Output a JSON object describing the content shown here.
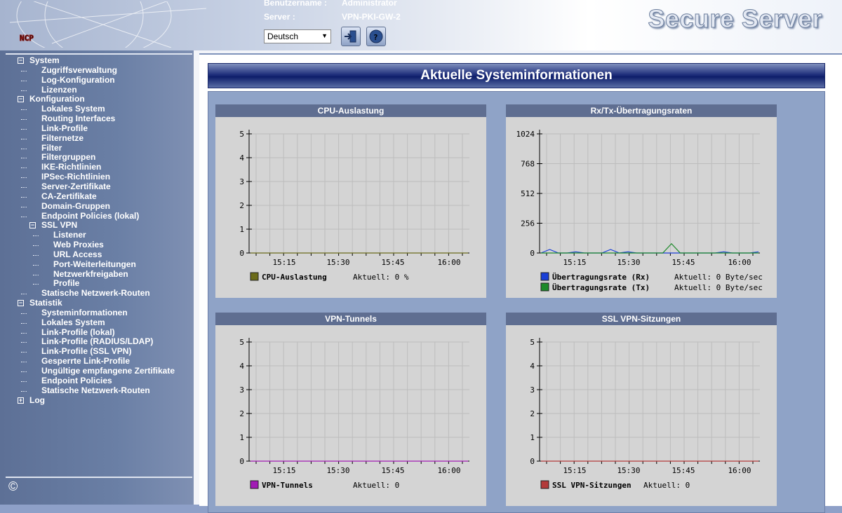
{
  "header": {
    "user_label": "Benutzername :",
    "user_value": "Administrator",
    "server_label": "Server :",
    "server_value": "VPN-PKI-GW-2",
    "language": "Deutsch",
    "logo_text": "NCP",
    "brand": "Secure Server",
    "icons": [
      "logout-icon",
      "help-icon"
    ]
  },
  "sidebar": {
    "copyright": "©",
    "tree": [
      {
        "label": "System",
        "level": 0,
        "expander": "minus"
      },
      {
        "label": "Zugriffsverwaltung",
        "level": 1
      },
      {
        "label": "Log-Konfiguration",
        "level": 1
      },
      {
        "label": "Lizenzen",
        "level": 1
      },
      {
        "label": "Konfiguration",
        "level": 0,
        "expander": "minus"
      },
      {
        "label": "Lokales System",
        "level": 1
      },
      {
        "label": "Routing Interfaces",
        "level": 1
      },
      {
        "label": "Link-Profile",
        "level": 1
      },
      {
        "label": "Filternetze",
        "level": 1
      },
      {
        "label": "Filter",
        "level": 1
      },
      {
        "label": "Filtergruppen",
        "level": 1
      },
      {
        "label": "IKE-Richtlinien",
        "level": 1
      },
      {
        "label": "IPSec-Richtlinien",
        "level": 1
      },
      {
        "label": "Server-Zertifikate",
        "level": 1
      },
      {
        "label": "CA-Zertifikate",
        "level": 1
      },
      {
        "label": "Domain-Gruppen",
        "level": 1
      },
      {
        "label": "Endpoint Policies (lokal)",
        "level": 1
      },
      {
        "label": "SSL VPN",
        "level": 1,
        "expander": "minus"
      },
      {
        "label": "Listener",
        "level": 2
      },
      {
        "label": "Web Proxies",
        "level": 2
      },
      {
        "label": "URL Access",
        "level": 2
      },
      {
        "label": "Port-Weiterleitungen",
        "level": 2
      },
      {
        "label": "Netzwerkfreigaben",
        "level": 2
      },
      {
        "label": "Profile",
        "level": 2
      },
      {
        "label": "Statische Netzwerk-Routen",
        "level": 1
      },
      {
        "label": "Statistik",
        "level": 0,
        "expander": "minus"
      },
      {
        "label": "Systeminformationen",
        "level": 1
      },
      {
        "label": "Lokales System",
        "level": 1
      },
      {
        "label": "Link-Profile (lokal)",
        "level": 1
      },
      {
        "label": "Link-Profile (RADIUS/LDAP)",
        "level": 1
      },
      {
        "label": "Link-Profile (SSL VPN)",
        "level": 1
      },
      {
        "label": "Gesperrte Link-Profile",
        "level": 1
      },
      {
        "label": "Ungültige empfangene Zertifikate",
        "level": 1
      },
      {
        "label": "Endpoint Policies",
        "level": 1
      },
      {
        "label": "Statische Netzwerk-Routen",
        "level": 1
      },
      {
        "label": "Log",
        "level": 0,
        "expander": "plus"
      }
    ]
  },
  "main": {
    "title": "Aktuelle Systeminformationen"
  },
  "chart_data": [
    {
      "type": "line",
      "title": "CPU-Auslastung",
      "ylim": [
        0,
        5
      ],
      "yticks": [
        "0",
        "1",
        "2",
        "3",
        "4",
        "5"
      ],
      "xticks": [
        "15:15",
        "15:30",
        "15:45",
        "16:00"
      ],
      "series": [
        {
          "name": "CPU-Auslastung",
          "color": "#6b6b1a",
          "current": "Aktuell: 0 %",
          "values": [
            0,
            0,
            0,
            0,
            0,
            0,
            0,
            0,
            0,
            0,
            0,
            0,
            0,
            0,
            0,
            0,
            0,
            0,
            0,
            0,
            0,
            0,
            0,
            0,
            0,
            0
          ]
        }
      ]
    },
    {
      "type": "line",
      "title": "Rx/Tx-Übertragungsraten",
      "ylim": [
        0,
        1024
      ],
      "yticks": [
        "0",
        "256",
        "512",
        "768",
        "1024"
      ],
      "xticks": [
        "15:15",
        "15:30",
        "15:45",
        "16:00"
      ],
      "series": [
        {
          "name": "Übertragungsrate (Rx)",
          "color": "#1a3fd6",
          "current": "Aktuell: 0 Byte/sec",
          "values": [
            0,
            30,
            0,
            0,
            10,
            0,
            0,
            0,
            30,
            0,
            10,
            0,
            0,
            0,
            0,
            0,
            0,
            0,
            0,
            0,
            0,
            10,
            0,
            0,
            0,
            10
          ]
        },
        {
          "name": "Übertragungsrate (Tx)",
          "color": "#1d8a2a",
          "current": "Aktuell: 0 Byte/sec",
          "values": [
            0,
            0,
            0,
            0,
            0,
            0,
            0,
            0,
            0,
            0,
            0,
            0,
            0,
            0,
            0,
            80,
            0,
            0,
            0,
            0,
            0,
            0,
            0,
            0,
            0,
            0
          ]
        }
      ]
    },
    {
      "type": "line",
      "title": "VPN-Tunnels",
      "ylim": [
        0,
        5
      ],
      "yticks": [
        "0",
        "1",
        "2",
        "3",
        "4",
        "5"
      ],
      "xticks": [
        "15:15",
        "15:30",
        "15:45",
        "16:00"
      ],
      "series": [
        {
          "name": "VPN-Tunnels",
          "color": "#a21bb5",
          "current": "Aktuell: 0",
          "values": [
            0,
            0,
            0,
            0,
            0,
            0,
            0,
            0,
            0,
            0,
            0,
            0,
            0,
            0,
            0,
            0,
            0,
            0,
            0,
            0,
            0,
            0,
            0,
            0,
            0,
            0
          ]
        }
      ]
    },
    {
      "type": "line",
      "title": "SSL VPN-Sitzungen",
      "ylim": [
        0,
        5
      ],
      "yticks": [
        "0",
        "1",
        "2",
        "3",
        "4",
        "5"
      ],
      "xticks": [
        "15:15",
        "15:30",
        "15:45",
        "16:00"
      ],
      "series": [
        {
          "name": "SSL VPN-Sitzungen",
          "color": "#b33a3a",
          "current": "Aktuell: 0",
          "values": [
            0,
            0,
            0,
            0,
            0,
            0,
            0,
            0,
            0,
            0,
            0,
            0,
            0,
            0,
            0,
            0,
            0,
            0,
            0,
            0,
            0,
            0,
            0,
            0,
            0,
            0
          ]
        }
      ]
    }
  ]
}
